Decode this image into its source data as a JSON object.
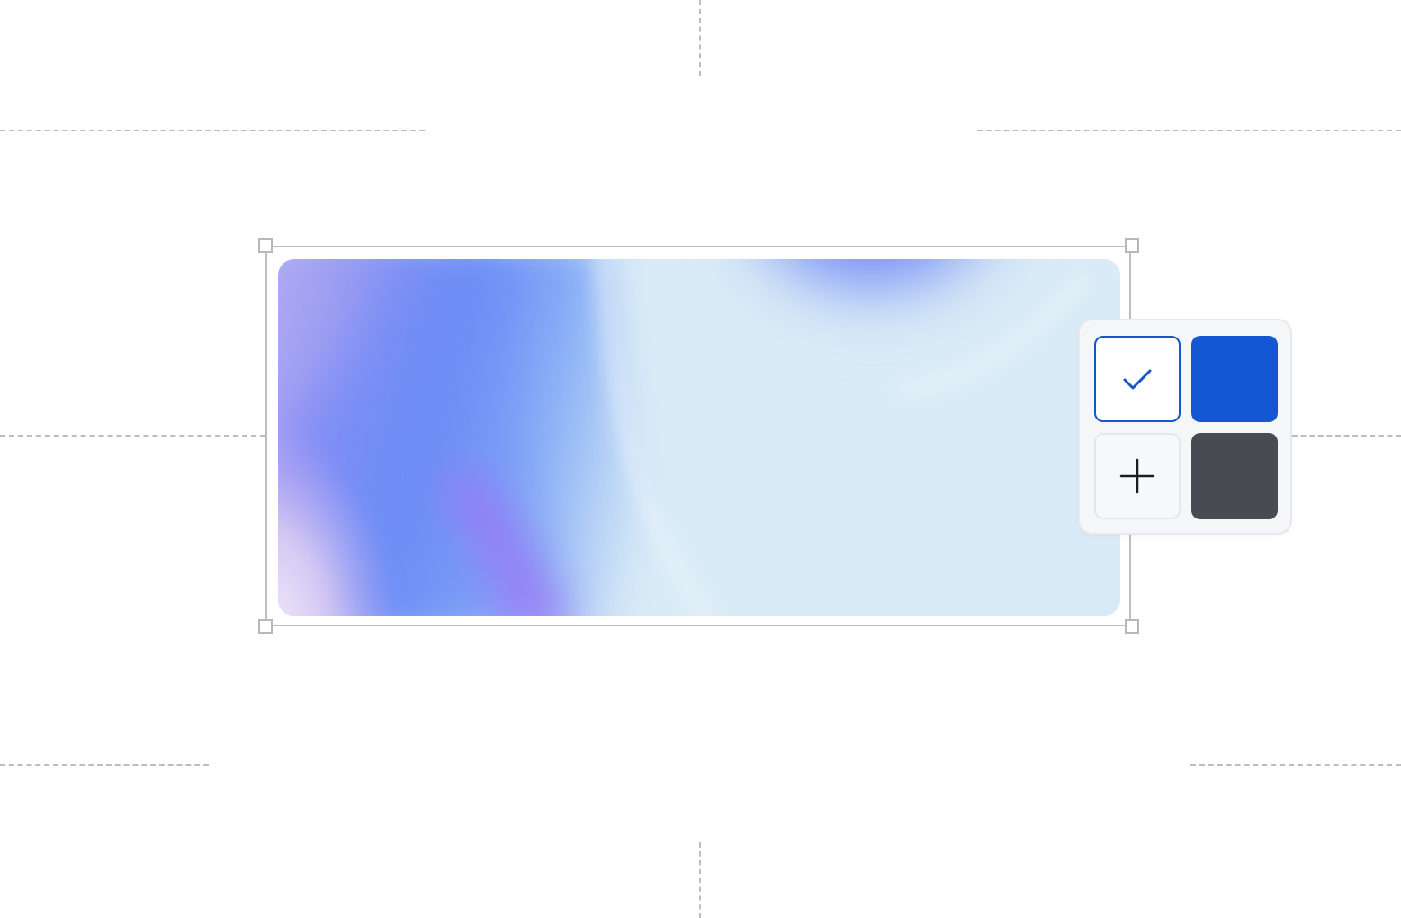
{
  "canvas": {
    "background": "#ffffff",
    "guide_color": "#bdbdbd"
  },
  "image": {
    "icon": "gradient-image",
    "colors": [
      "#a48cf2",
      "#6a8cf6",
      "#5b94f3",
      "#9f7cf7",
      "#d9ebf6",
      "#8a78f5"
    ]
  },
  "color_picker": {
    "swatches": [
      {
        "name": "white",
        "color": "#ffffff",
        "selected": true,
        "icon": "check-icon",
        "border": "#1656cd"
      },
      {
        "name": "blue",
        "color": "#1456d4",
        "selected": false
      },
      {
        "name": "add",
        "color": "#f7f8fa",
        "icon": "plus-icon"
      },
      {
        "name": "dark",
        "color": "#4a4a53",
        "selected": false
      }
    ]
  }
}
